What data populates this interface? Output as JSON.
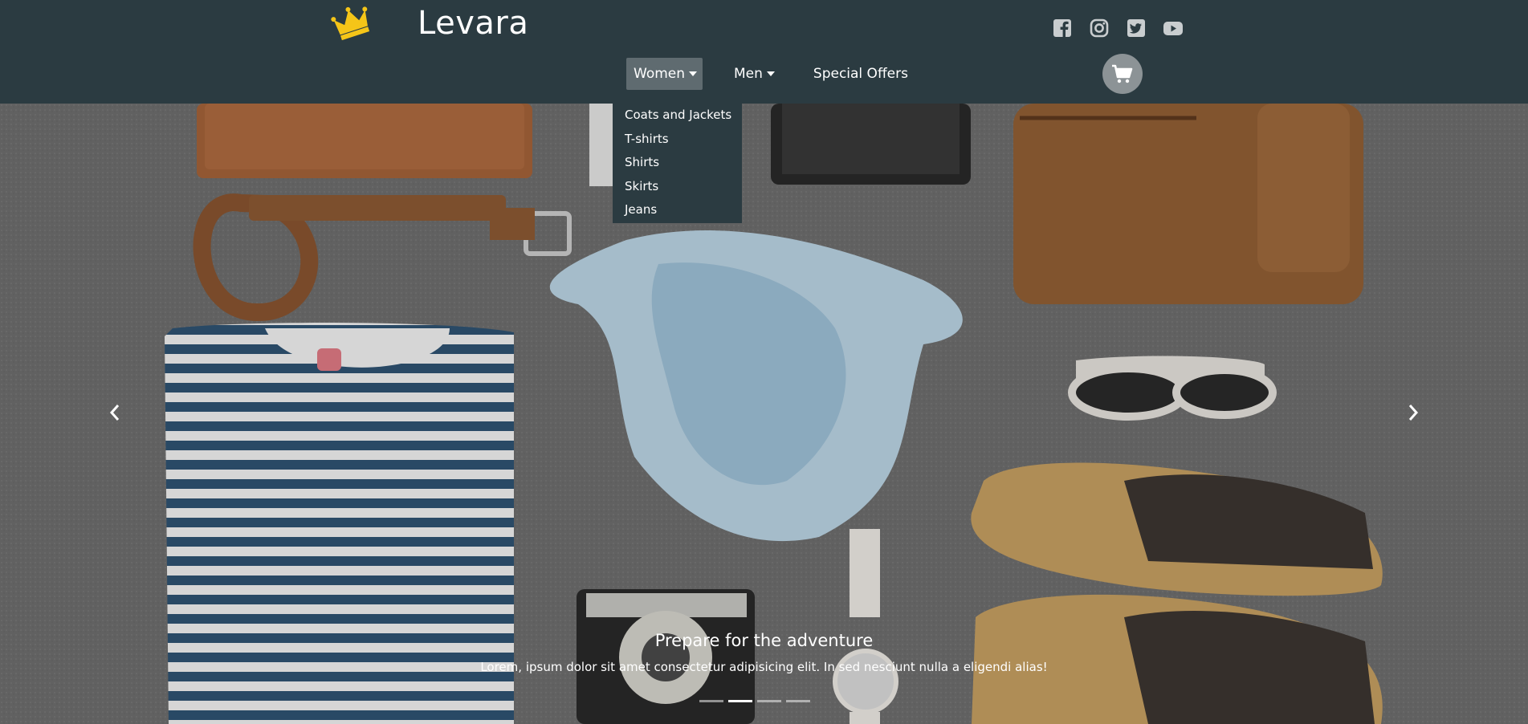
{
  "brand": {
    "name": "Levara",
    "logo_icon": "crown-icon",
    "logo_color": "#f5c518"
  },
  "social": [
    {
      "icon": "facebook-icon",
      "label": "Facebook"
    },
    {
      "icon": "instagram-icon",
      "label": "Instagram"
    },
    {
      "icon": "twitter-icon",
      "label": "Twitter"
    },
    {
      "icon": "youtube-icon",
      "label": "YouTube"
    }
  ],
  "nav": {
    "women": "Women",
    "men": "Men",
    "offers": "Special Offers"
  },
  "cart": {
    "icon": "cart-icon"
  },
  "dropdown": {
    "items": [
      "Coats and Jackets",
      "T-shirts",
      "Shirts",
      "Skirts",
      "Jeans"
    ]
  },
  "carousel": {
    "title": "Prepare for the adventure",
    "text": "Lorem, ipsum dolor sit amet consectetur adipisicing elit. In sed nesciunt nulla a eligendi alias!",
    "slide_count": 4,
    "active_slide": 1,
    "prev_icon": "chevron-left-icon",
    "next_icon": "chevron-right-icon"
  },
  "colors": {
    "header_bg": "#2b3b41",
    "active_nav_bg": "#5f6b70",
    "cart_bg": "#8c9396"
  }
}
